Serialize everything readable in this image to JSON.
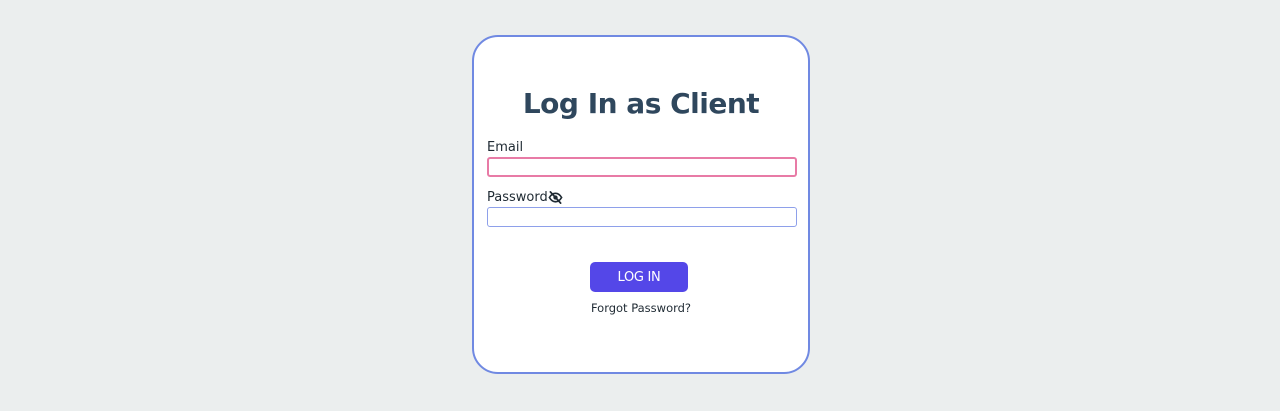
{
  "login_form": {
    "title": "Log In as Client",
    "email": {
      "label": "Email",
      "value": "",
      "placeholder": ""
    },
    "password": {
      "label": "Password",
      "value": "",
      "placeholder": "",
      "toggle_icon": "eye-slash-icon"
    },
    "submit_label": "LOG IN",
    "forgot_password_label": "Forgot Password?"
  },
  "colors": {
    "background": "#ebeeee",
    "card_border": "#7089e2",
    "title": "#2f475d",
    "email_border": "#e87ba6",
    "password_border": "#8ea0ea",
    "button": "#5447e8",
    "button_text": "#ffffff"
  }
}
